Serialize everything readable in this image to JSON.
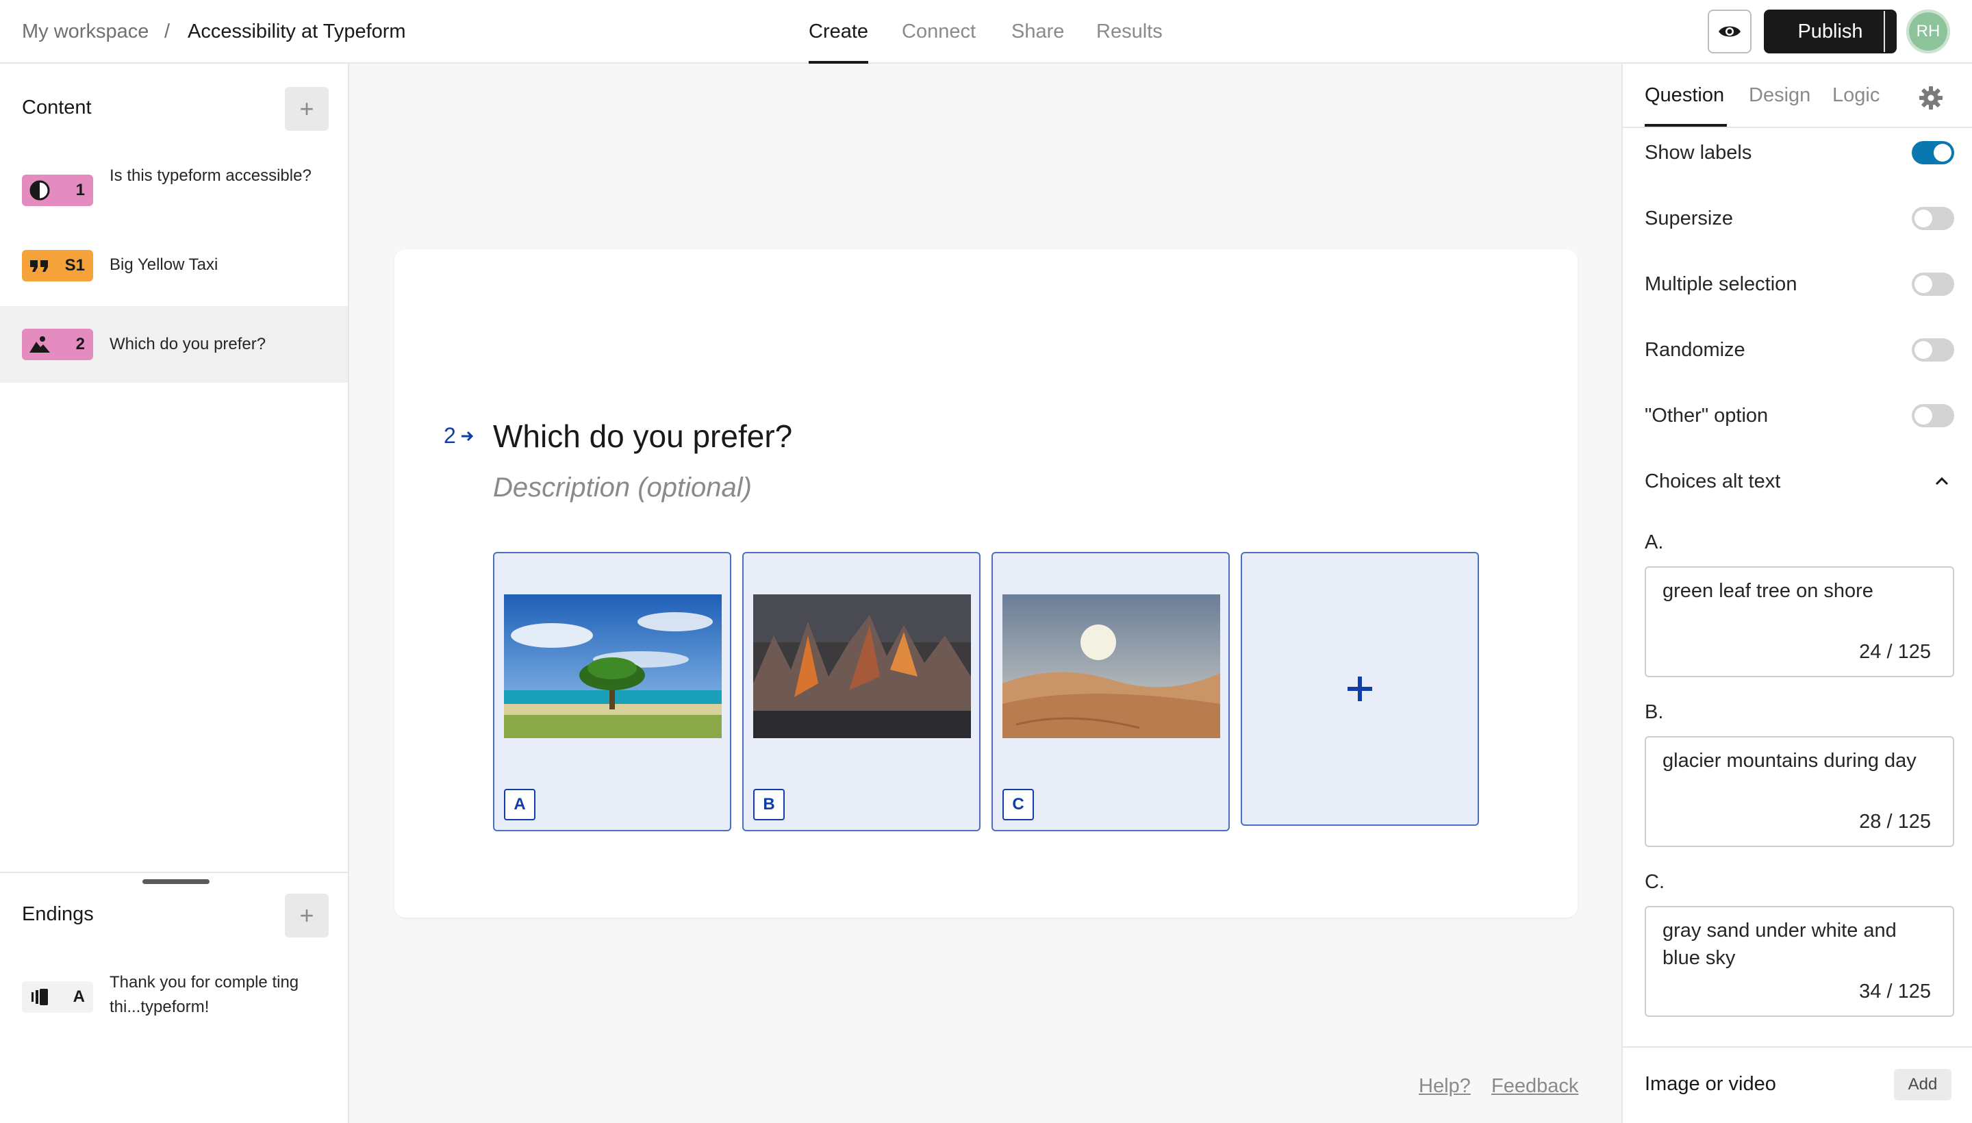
{
  "breadcrumb": {
    "workspace": "My workspace",
    "separator": "/",
    "current": "Accessibility at Typeform"
  },
  "nav": {
    "tabs": [
      "Create",
      "Connect",
      "Share",
      "Results"
    ],
    "active": "Create"
  },
  "header": {
    "publish_label": "Publish",
    "avatar_initials": "RH",
    "preview_icon": "eye-icon"
  },
  "sidebar": {
    "content_title": "Content",
    "questions": [
      {
        "badge": "1",
        "label": "Is this typeform accessible?",
        "icon": "contrast-icon",
        "color": "#e48bbf"
      },
      {
        "badge": "S1",
        "label": "Big Yellow Taxi",
        "icon": "quote-icon",
        "color": "#f5a23a"
      },
      {
        "badge": "2",
        "label": "Which do you prefer?",
        "icon": "picture-choice-icon",
        "color": "#e48bbf"
      }
    ],
    "endings_title": "Endings",
    "endings": [
      {
        "badge": "A",
        "label": "Thank you for comple ting thi...typeform!",
        "icon": "ending-icon"
      }
    ]
  },
  "question": {
    "number": "2",
    "title": "Which do you prefer?",
    "description_placeholder": "Description (optional)",
    "choices": [
      {
        "key": "A",
        "image": "tree-on-shore"
      },
      {
        "key": "B",
        "image": "glacier-mountains"
      },
      {
        "key": "C",
        "image": "desert-sand"
      }
    ]
  },
  "footer": {
    "help": "Help?",
    "feedback": "Feedback"
  },
  "panel": {
    "tabs": [
      "Question",
      "Design",
      "Logic"
    ],
    "active_tab": "Question",
    "options": [
      {
        "label": "Show labels",
        "on": true
      },
      {
        "label": "Supersize",
        "on": false
      },
      {
        "label": "Multiple selection",
        "on": false
      },
      {
        "label": "Randomize",
        "on": false
      },
      {
        "label": "\"Other\" option",
        "on": false
      }
    ],
    "alt_section_title": "Choices alt text",
    "alt_texts": [
      {
        "letter": "A.",
        "text": "green leaf tree on shore",
        "count": "24 / 125"
      },
      {
        "letter": "B.",
        "text": "glacier mountains during day",
        "count": "28 / 125"
      },
      {
        "letter": "C.",
        "text": "gray sand under white and blue sky",
        "count": "34 / 125"
      }
    ],
    "media_label": "Image or video",
    "media_add": "Add"
  },
  "colors": {
    "accent": "#0f3ea8",
    "toggle_on": "#0a78b0",
    "choice_bg": "#e8edf8"
  }
}
